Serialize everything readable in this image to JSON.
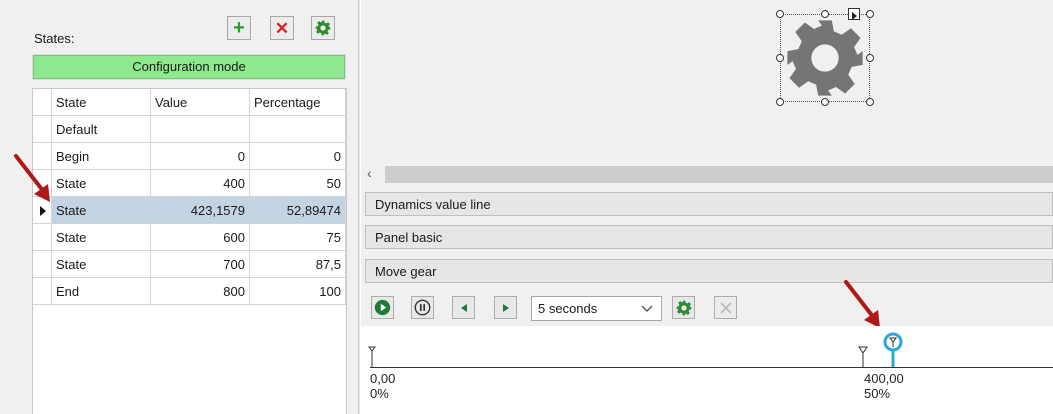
{
  "states_panel": {
    "label": "States:",
    "add_button": "+",
    "delete_button": "✕",
    "settings_icon": "gear-icon",
    "mode_banner": "Configuration mode",
    "mode_color": "#8ee88e"
  },
  "table": {
    "columns": [
      "State",
      "Value",
      "Percentage"
    ],
    "rows": [
      {
        "state": "Default",
        "value": "",
        "percentage": ""
      },
      {
        "state": "Begin",
        "value": "0",
        "percentage": "0"
      },
      {
        "state": "State",
        "value": "400",
        "percentage": "50"
      },
      {
        "state": "State",
        "value": "423,1579",
        "percentage": "52,89474",
        "selected": true
      },
      {
        "state": "State",
        "value": "600",
        "percentage": "75"
      },
      {
        "state": "State",
        "value": "700",
        "percentage": "87,5"
      },
      {
        "state": "End",
        "value": "800",
        "percentage": "100"
      }
    ],
    "selected_row_color": "#c2d3e3"
  },
  "canvas": {
    "object_icon": "gear-icon"
  },
  "panels": {
    "dynamics": "Dynamics value line",
    "panel_basic": "Panel basic",
    "move_gear": "Move gear"
  },
  "playback": {
    "duration": "5 seconds",
    "buttons": [
      "play-icon",
      "pause-icon",
      "step-back-icon",
      "step-forward-icon",
      "gear-icon",
      "close-icon"
    ]
  },
  "timeline": {
    "start_value": "0,00",
    "start_percent": "0%",
    "mark_value": "400,00",
    "mark_percent": "50%",
    "cursor_color": "#2aa8d8"
  },
  "annotation_color": "#b01818"
}
